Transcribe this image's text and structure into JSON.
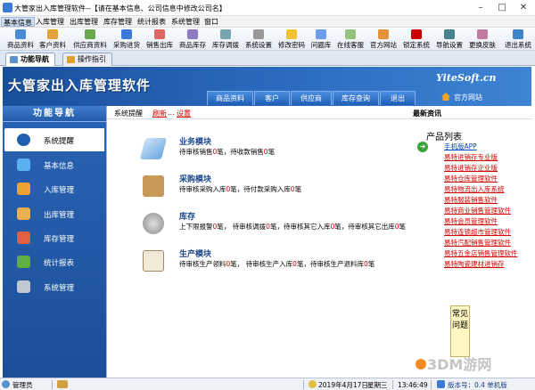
{
  "window": {
    "title": "大管家出入库管理软件--【请在基本信息、公司信息中修改公司名】",
    "controls": [
      "–",
      "□",
      "✕"
    ]
  },
  "menu": [
    "基本信息",
    "入库管理",
    "出库管理",
    "库存管理",
    "统计报表",
    "系统管理",
    "窗口"
  ],
  "toolbar": [
    "商品资料",
    "客户资料",
    "供应商资料",
    "采购进货",
    "销售出库",
    "商品库存",
    "库存调拨",
    "系统设置",
    "修改密码",
    "问题库",
    "在线客服",
    "官方网站",
    "锁定系统",
    "导航设置",
    "更换皮肤",
    "退出系统"
  ],
  "tabs": [
    "功能导航",
    "操作指引"
  ],
  "banner": {
    "title": "大管家出入库管理软件",
    "site": "YiteSoft.cn",
    "official": "官方网站",
    "nav": [
      "商品资料",
      "客户",
      "供应商",
      "库存查询",
      "退出"
    ]
  },
  "sidebar": {
    "header": "功能导航",
    "items": [
      "系统提醒",
      "基本信息",
      "入库管理",
      "出库管理",
      "库存管理",
      "统计报表",
      "系统管理"
    ]
  },
  "main": {
    "crumb_label": "系统提醒",
    "refresh": "刷新",
    "settings": "设置",
    "news": "最新资讯",
    "modules": [
      {
        "title": "业务模块",
        "desc": [
          "待审核销售",
          "0",
          "笔，待收款销售",
          "0",
          "笔"
        ]
      },
      {
        "title": "采购模块",
        "desc": [
          "待审核采购入库",
          "0",
          "笔，待付款采购入库",
          "0",
          "笔"
        ]
      },
      {
        "title": "库存",
        "desc": [
          "上下限报警",
          "0",
          "笔，  待审核调拨",
          "0",
          "笔，待审核其它入库",
          "0",
          "笔，待审核其它出库",
          "0",
          "笔"
        ]
      },
      {
        "title": "生产模块",
        "desc": [
          "待审核生产领料",
          "0",
          "笔，  待审核生产入库",
          "0",
          "笔，待审核生产退料库",
          "0",
          "笔"
        ]
      }
    ],
    "products": {
      "heading": "产品列表",
      "items": [
        "手机版APP",
        "易特进销存专业版",
        "易特进销存企业版",
        "易特仓库管理软件",
        "易特物流出入库系统",
        "易特服装销售软件",
        "易特商业销售管理软件",
        "易特会员管理软件",
        "易特连锁超市管理软件",
        "易特汽配销售管理软件",
        "易特五金店销售管理软件",
        "易特陶瓷建材进销存"
      ]
    },
    "faq": "常见问题"
  },
  "watermark": "3DM游网",
  "status": {
    "user": "管理员",
    "date": "2019年4月17日",
    "weekday": "星期三",
    "time": "13:46:49",
    "version": "版本号：0.4 单机版"
  }
}
